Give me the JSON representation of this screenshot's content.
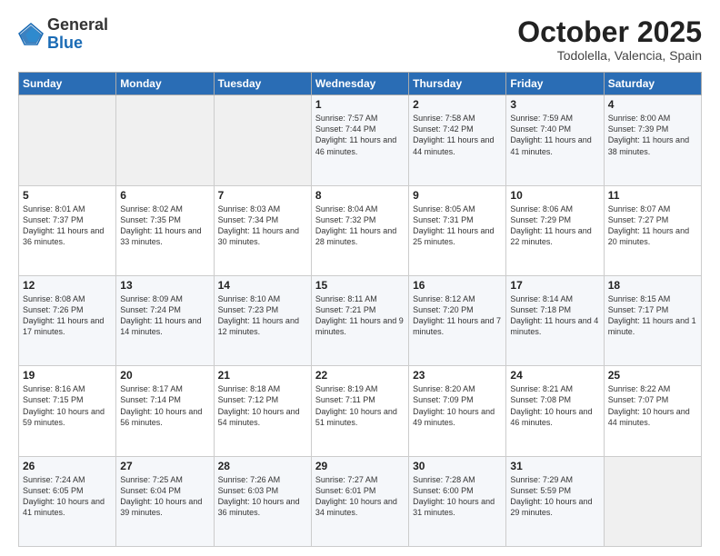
{
  "header": {
    "logo": {
      "general": "General",
      "blue": "Blue"
    },
    "title": "October 2025",
    "subtitle": "Todolella, Valencia, Spain"
  },
  "weekdays": [
    "Sunday",
    "Monday",
    "Tuesday",
    "Wednesday",
    "Thursday",
    "Friday",
    "Saturday"
  ],
  "weeks": [
    [
      {
        "day": "",
        "info": ""
      },
      {
        "day": "",
        "info": ""
      },
      {
        "day": "",
        "info": ""
      },
      {
        "day": "1",
        "info": "Sunrise: 7:57 AM\nSunset: 7:44 PM\nDaylight: 11 hours\nand 46 minutes."
      },
      {
        "day": "2",
        "info": "Sunrise: 7:58 AM\nSunset: 7:42 PM\nDaylight: 11 hours\nand 44 minutes."
      },
      {
        "day": "3",
        "info": "Sunrise: 7:59 AM\nSunset: 7:40 PM\nDaylight: 11 hours\nand 41 minutes."
      },
      {
        "day": "4",
        "info": "Sunrise: 8:00 AM\nSunset: 7:39 PM\nDaylight: 11 hours\nand 38 minutes."
      }
    ],
    [
      {
        "day": "5",
        "info": "Sunrise: 8:01 AM\nSunset: 7:37 PM\nDaylight: 11 hours\nand 36 minutes."
      },
      {
        "day": "6",
        "info": "Sunrise: 8:02 AM\nSunset: 7:35 PM\nDaylight: 11 hours\nand 33 minutes."
      },
      {
        "day": "7",
        "info": "Sunrise: 8:03 AM\nSunset: 7:34 PM\nDaylight: 11 hours\nand 30 minutes."
      },
      {
        "day": "8",
        "info": "Sunrise: 8:04 AM\nSunset: 7:32 PM\nDaylight: 11 hours\nand 28 minutes."
      },
      {
        "day": "9",
        "info": "Sunrise: 8:05 AM\nSunset: 7:31 PM\nDaylight: 11 hours\nand 25 minutes."
      },
      {
        "day": "10",
        "info": "Sunrise: 8:06 AM\nSunset: 7:29 PM\nDaylight: 11 hours\nand 22 minutes."
      },
      {
        "day": "11",
        "info": "Sunrise: 8:07 AM\nSunset: 7:27 PM\nDaylight: 11 hours\nand 20 minutes."
      }
    ],
    [
      {
        "day": "12",
        "info": "Sunrise: 8:08 AM\nSunset: 7:26 PM\nDaylight: 11 hours\nand 17 minutes."
      },
      {
        "day": "13",
        "info": "Sunrise: 8:09 AM\nSunset: 7:24 PM\nDaylight: 11 hours\nand 14 minutes."
      },
      {
        "day": "14",
        "info": "Sunrise: 8:10 AM\nSunset: 7:23 PM\nDaylight: 11 hours\nand 12 minutes."
      },
      {
        "day": "15",
        "info": "Sunrise: 8:11 AM\nSunset: 7:21 PM\nDaylight: 11 hours\nand 9 minutes."
      },
      {
        "day": "16",
        "info": "Sunrise: 8:12 AM\nSunset: 7:20 PM\nDaylight: 11 hours\nand 7 minutes."
      },
      {
        "day": "17",
        "info": "Sunrise: 8:14 AM\nSunset: 7:18 PM\nDaylight: 11 hours\nand 4 minutes."
      },
      {
        "day": "18",
        "info": "Sunrise: 8:15 AM\nSunset: 7:17 PM\nDaylight: 11 hours\nand 1 minute."
      }
    ],
    [
      {
        "day": "19",
        "info": "Sunrise: 8:16 AM\nSunset: 7:15 PM\nDaylight: 10 hours\nand 59 minutes."
      },
      {
        "day": "20",
        "info": "Sunrise: 8:17 AM\nSunset: 7:14 PM\nDaylight: 10 hours\nand 56 minutes."
      },
      {
        "day": "21",
        "info": "Sunrise: 8:18 AM\nSunset: 7:12 PM\nDaylight: 10 hours\nand 54 minutes."
      },
      {
        "day": "22",
        "info": "Sunrise: 8:19 AM\nSunset: 7:11 PM\nDaylight: 10 hours\nand 51 minutes."
      },
      {
        "day": "23",
        "info": "Sunrise: 8:20 AM\nSunset: 7:09 PM\nDaylight: 10 hours\nand 49 minutes."
      },
      {
        "day": "24",
        "info": "Sunrise: 8:21 AM\nSunset: 7:08 PM\nDaylight: 10 hours\nand 46 minutes."
      },
      {
        "day": "25",
        "info": "Sunrise: 8:22 AM\nSunset: 7:07 PM\nDaylight: 10 hours\nand 44 minutes."
      }
    ],
    [
      {
        "day": "26",
        "info": "Sunrise: 7:24 AM\nSunset: 6:05 PM\nDaylight: 10 hours\nand 41 minutes."
      },
      {
        "day": "27",
        "info": "Sunrise: 7:25 AM\nSunset: 6:04 PM\nDaylight: 10 hours\nand 39 minutes."
      },
      {
        "day": "28",
        "info": "Sunrise: 7:26 AM\nSunset: 6:03 PM\nDaylight: 10 hours\nand 36 minutes."
      },
      {
        "day": "29",
        "info": "Sunrise: 7:27 AM\nSunset: 6:01 PM\nDaylight: 10 hours\nand 34 minutes."
      },
      {
        "day": "30",
        "info": "Sunrise: 7:28 AM\nSunset: 6:00 PM\nDaylight: 10 hours\nand 31 minutes."
      },
      {
        "day": "31",
        "info": "Sunrise: 7:29 AM\nSunset: 5:59 PM\nDaylight: 10 hours\nand 29 minutes."
      },
      {
        "day": "",
        "info": ""
      }
    ]
  ]
}
